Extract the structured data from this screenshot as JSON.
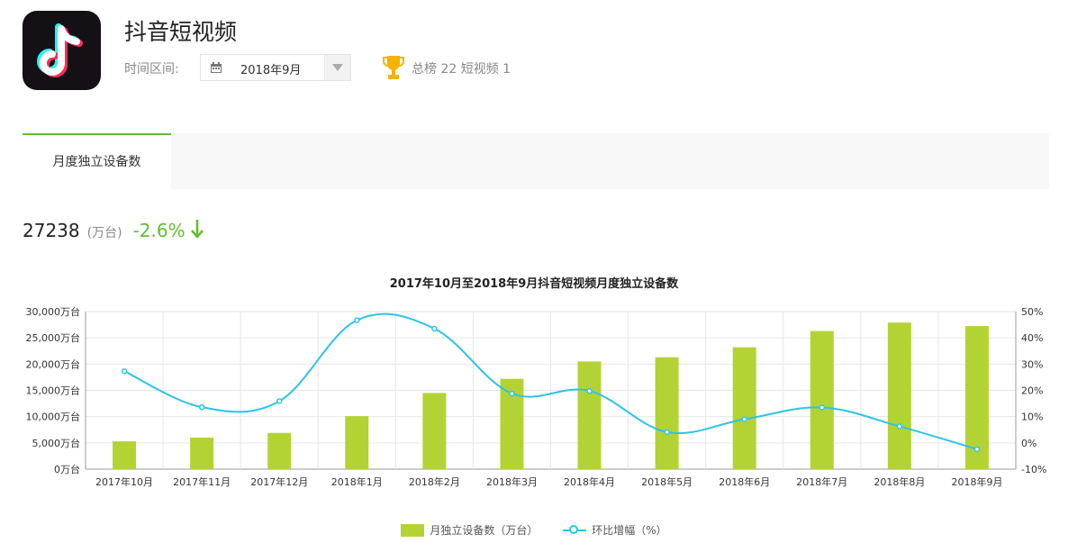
{
  "app": {
    "name": "抖音短视频",
    "icon": "tiktok-logo-icon"
  },
  "filter": {
    "label": "时间区间:",
    "value": "2018年9月",
    "icon": "calendar-icon",
    "dropdown_icon": "caret-down-icon"
  },
  "rank": {
    "icon": "trophy-icon",
    "text": "总榜 22  短视频 1",
    "trophy_color": "#f2b400"
  },
  "tabs": [
    {
      "label": "月度独立设备数",
      "active": true
    }
  ],
  "metric": {
    "value": "27238",
    "unit": "(万台)",
    "change": "-2.6%",
    "trend_icon": "arrow-down-icon",
    "change_color": "#5fbe2f"
  },
  "chart_data": {
    "type": "bar",
    "title": "2017年10月至2018年9月抖音短视频月度独立设备数",
    "categories": [
      "2017年10月",
      "2017年11月",
      "2017年12月",
      "2018年1月",
      "2018年2月",
      "2018年3月",
      "2018年4月",
      "2018年5月",
      "2018年6月",
      "2018年7月",
      "2018年8月",
      "2018年9月"
    ],
    "series": [
      {
        "name": "月独立设备数（万台）",
        "type": "bar",
        "axis": "left",
        "color": "#b3d335",
        "values": [
          5300,
          6000,
          6900,
          10100,
          14500,
          17200,
          20500,
          21300,
          23200,
          26300,
          27900,
          27238
        ]
      },
      {
        "name": "环比增幅（%）",
        "type": "line",
        "axis": "right",
        "color": "#2bc4e8",
        "values": [
          27.3,
          13.6,
          15.9,
          46.7,
          43.5,
          18.8,
          19.8,
          4.1,
          9.0,
          13.5,
          6.3,
          -2.4
        ]
      }
    ],
    "y_left": {
      "min": 0,
      "max": 30000,
      "ticks": [
        "0万台",
        "5,000万台",
        "10,000万台",
        "15,000万台",
        "20,000万台",
        "25,000万台",
        "30,000万台"
      ]
    },
    "y_right": {
      "min": -10,
      "max": 50,
      "ticks": [
        "-10%",
        "0%",
        "10%",
        "20%",
        "30%",
        "40%",
        "50%"
      ]
    },
    "grid": true,
    "legend_position": "bottom"
  }
}
